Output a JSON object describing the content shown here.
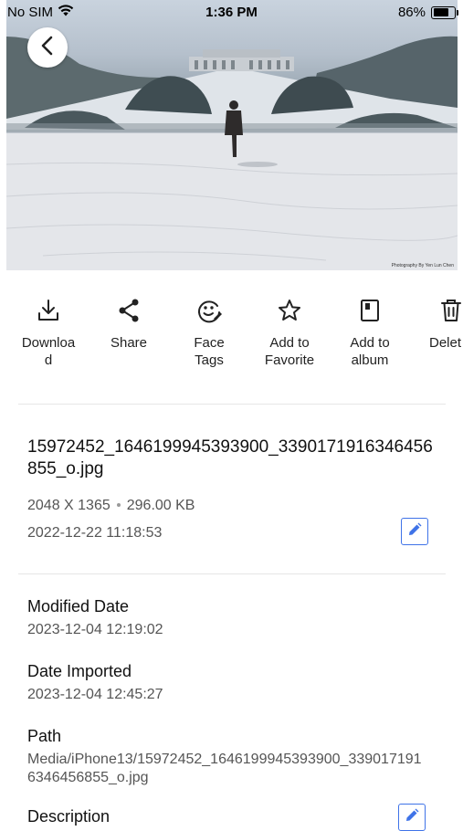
{
  "status_bar": {
    "carrier": "No SIM",
    "time": "1:36 PM",
    "battery": "86%",
    "battery_level": 0.86
  },
  "photo": {
    "credit": "Photography By Yen Lun Chen"
  },
  "actions": [
    {
      "label": "Downloa\nd",
      "icon": "download-icon"
    },
    {
      "label": "Share",
      "icon": "share-icon"
    },
    {
      "label": "Face\nTags",
      "icon": "face-tag-icon"
    },
    {
      "label": "Add to\nFavorite",
      "icon": "star-icon"
    },
    {
      "label": "Add to\nalbum",
      "icon": "album-icon"
    },
    {
      "label": "Delet",
      "icon": "trash-icon"
    }
  ],
  "file": {
    "name": "15972452_1646199945393900_3390171916346456855_o.jpg",
    "dimensions": "2048 X 1365",
    "size": "296.00 KB",
    "date": "2022-12-22 11:18:53"
  },
  "details": {
    "modified_title": "Modified Date",
    "modified_value": "2023-12-04 12:19:02",
    "imported_title": "Date Imported",
    "imported_value": "2023-12-04 12:45:27",
    "path_title": "Path",
    "path_value": "Media/iPhone13/15972452_1646199945393900_3390171916346456855_o.jpg",
    "description_title": "Description"
  },
  "colors": {
    "accent": "#3f73e8"
  }
}
